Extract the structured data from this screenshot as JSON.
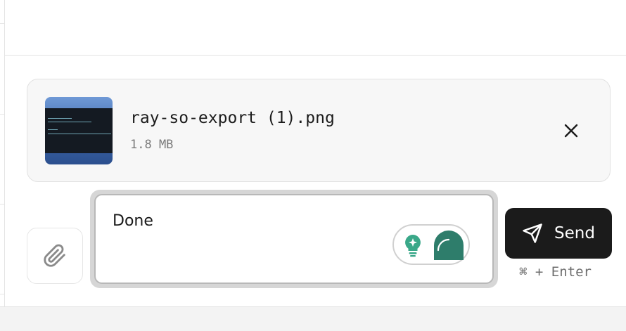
{
  "attachment": {
    "file_name": "ray-so-export (1).png",
    "file_size": "1.8 MB",
    "thumbnail_icon": "image-thumbnail",
    "remove_icon": "close-icon"
  },
  "composer": {
    "message_text": "Done",
    "attach_icon": "paperclip-icon",
    "hint_icon": "lightbulb-sparkle-icon",
    "speech_icon": "speech-bubble-icon",
    "accent_color": "#2e7d6b"
  },
  "send": {
    "label": "Send",
    "icon": "paper-plane-icon",
    "shortcut": "⌘ + Enter",
    "background": "#1b1b1b"
  }
}
